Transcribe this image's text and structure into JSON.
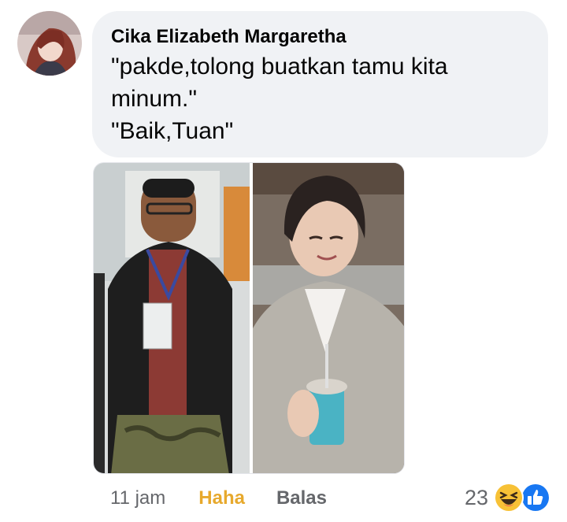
{
  "comment": {
    "author": "Cika Elizabeth Margaretha",
    "lines": [
      "\"pakde,tolong buatkan tamu kita",
      "minum.\"",
      "\"Baik,Tuan\""
    ]
  },
  "actions": {
    "time": "11 jam",
    "reaction_label": "Haha",
    "reply_label": "Balas"
  },
  "reactions": {
    "count": "23",
    "icons": [
      "haha-icon",
      "like-icon"
    ]
  },
  "colors": {
    "bubble": "#f0f2f5",
    "haha_text": "#e7a92d",
    "meta_text": "#65676b",
    "like_blue": "#1877f2"
  }
}
